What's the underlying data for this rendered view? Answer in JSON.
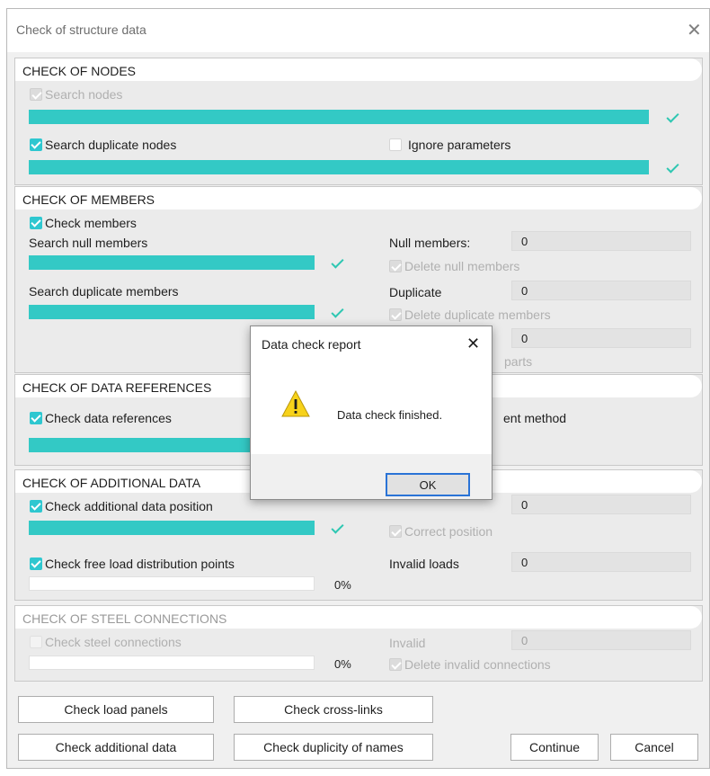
{
  "window": {
    "title": "Check of structure data",
    "close_glyph": "✕"
  },
  "nodes": {
    "header": "CHECK OF NODES",
    "search_nodes": "Search nodes",
    "search_duplicate": "Search duplicate nodes",
    "ignore_parameters": "Ignore parameters",
    "search_nodes_progress": 1.0,
    "search_duplicate_progress": 1.0
  },
  "members": {
    "header": "CHECK OF MEMBERS",
    "check_members": "Check members",
    "search_null": "Search null members",
    "null_members_label": "Null members:",
    "null_members_value": "0",
    "delete_null": "Delete null members",
    "search_duplicate": "Search duplicate members",
    "duplicate_label": "Duplicate",
    "duplicate_value": "0",
    "delete_duplicate": "Delete duplicate members",
    "third_value": "0",
    "parts_text": "parts"
  },
  "references": {
    "header": "CHECK OF DATA REFERENCES",
    "check_refs": "Check data references",
    "method_text": "ent method"
  },
  "additional": {
    "header": "CHECK OF ADDITIONAL DATA",
    "check_position": "Check additional data position",
    "position_value": "0",
    "correct_position": "Correct position",
    "check_free_load": "Check free load distribution points",
    "invalid_loads_label": "Invalid loads",
    "invalid_loads_value": "0",
    "free_load_progress_text": "0%"
  },
  "steel": {
    "header": "CHECK OF STEEL CONNECTIONS",
    "check_steel": "Check steel connections",
    "invalid_label": "Invalid",
    "invalid_value": "0",
    "delete_invalid": "Delete invalid connections",
    "progress_text": "0%"
  },
  "buttons": {
    "load_panels": "Check load panels",
    "cross_links": "Check cross-links",
    "additional_data": "Check additional data",
    "duplicity_names": "Check duplicity of names",
    "continue": "Continue",
    "cancel": "Cancel"
  },
  "dialog": {
    "title": "Data check report",
    "close_glyph": "✕",
    "message": "Data check finished.",
    "ok": "OK",
    "icon": "warning-icon"
  },
  "colors": {
    "accent": "#33c9c5",
    "warning": "#f7d21a"
  }
}
